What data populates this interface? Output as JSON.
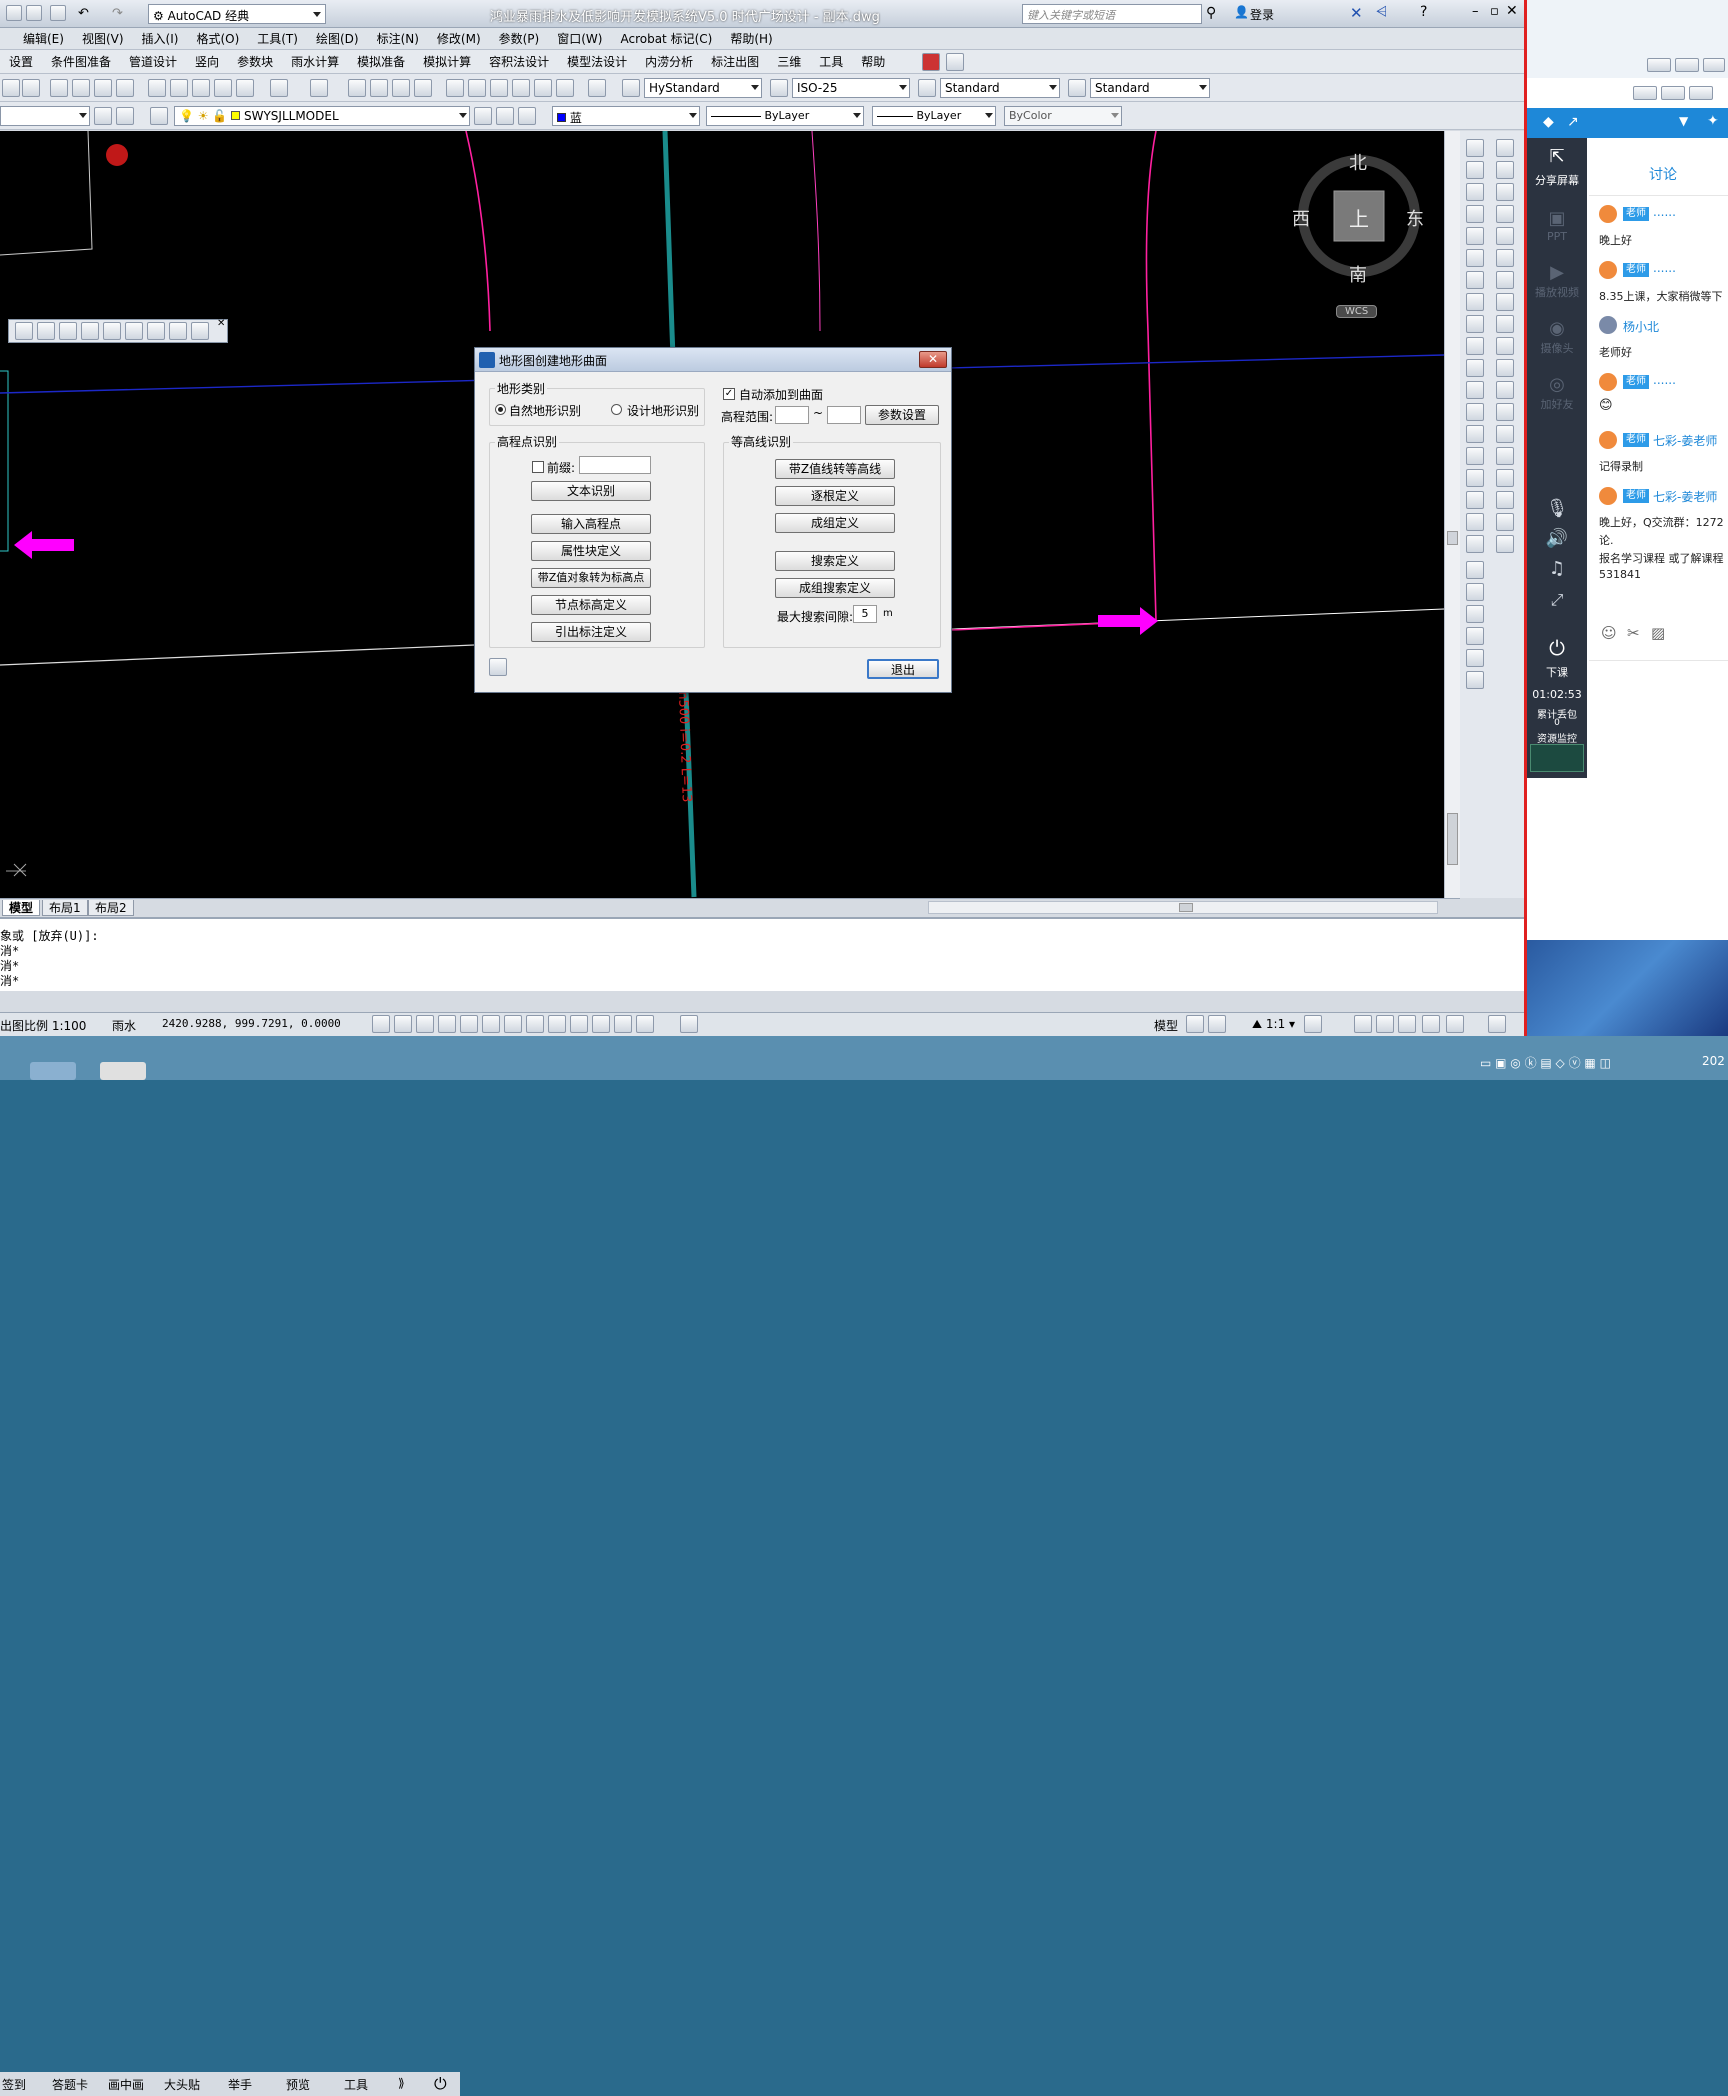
{
  "window": {
    "title": "鸿业暴雨排水及低影响开发模拟系统V5.0    时代广场设计 - 副本.dwg",
    "workspace": "AutoCAD 经典",
    "search_placeholder": "键入关键字或短语",
    "login": "登录"
  },
  "menubar": [
    "编辑(E)",
    "视图(V)",
    "插入(I)",
    "格式(O)",
    "工具(T)",
    "绘图(D)",
    "标注(N)",
    "修改(M)",
    "参数(P)",
    "窗口(W)",
    "Acrobat 标记(C)",
    "帮助(H)"
  ],
  "menubar2": [
    "设置",
    "条件图准备",
    "管道设计",
    "竖向",
    "参数块",
    "雨水计算",
    "模拟准备",
    "模拟计算",
    "容积法设计",
    "模型法设计",
    "内涝分析",
    "标注出图",
    "三维",
    "工具",
    "帮助"
  ],
  "styles": {
    "text_style": "HyStandard",
    "dim_style": "ISO-25",
    "table_style": "Standard",
    "mleader_style": "Standard"
  },
  "layers": {
    "layer_name": "SWYSJLLMODEL",
    "color": "蓝",
    "linetype": "ByLayer",
    "lineweight": "ByLayer",
    "plotstyle": "ByColor"
  },
  "viewcube": {
    "north": "北",
    "south": "南",
    "east": "东",
    "west": "西",
    "top": "上",
    "wcs": "WCS"
  },
  "canvas_label": "n500 i=0.2 L=13",
  "tabs": [
    "模型",
    "布局1",
    "布局2"
  ],
  "command_lines": [
    "象或 [放弃(U)]:",
    "消*",
    "消*",
    "消*"
  ],
  "status": {
    "scale_label": "出图比例 1:100",
    "mode": "雨水",
    "coords": "2420.9288, 999.7291, 0.0000",
    "model_btn": "模型",
    "annot_scale": "1:1"
  },
  "dialog": {
    "title": "地形图创建地形曲面",
    "terrain_type_label": "地形类别",
    "radio_natural": "自然地形识别",
    "radio_design": "设计地形识别",
    "auto_add": "自动添加到曲面",
    "elev_range": "高程范围:",
    "tilde": "~",
    "param_btn": "参数设置",
    "elev_point_group": "高程点识别",
    "prefix": "前缀:",
    "btn_text_recognize": "文本识别",
    "btn_input_point": "输入高程点",
    "btn_attr_block": "属性块定义",
    "btn_z_to_point": "带Z值对象转为标高点",
    "btn_node_elev": "节点标高定义",
    "btn_leader": "引出标注定义",
    "contour_group": "等高线识别",
    "btn_z_to_contour": "带Z值线转等高线",
    "btn_one_by_one": "逐根定义",
    "btn_group_def": "成组定义",
    "btn_search_def": "搜索定义",
    "btn_group_search": "成组搜索定义",
    "max_gap": "最大搜索间隙:",
    "max_gap_value": "5",
    "unit": "m",
    "exit": "退出"
  },
  "taskbar": [
    "签到",
    "答题卡",
    "画中画",
    "大头贴",
    "举手",
    "预览",
    "工具"
  ],
  "chat": {
    "tab": "讨论",
    "share": "分享屏幕",
    "side_items": [
      "PPT",
      "播放视频",
      "摄像头",
      "加好友"
    ],
    "end_class": "下课",
    "timer": "01:02:53",
    "stat1": "累计丢包",
    "stat1_value": "0",
    "stat2": "资源监控",
    "messages": [
      {
        "name": "老师",
        "extra": "......",
        "text": "晚上好"
      },
      {
        "name": "老师",
        "extra": "......",
        "text": "8.35上课，大家稍微等下"
      },
      {
        "name": "杨小北",
        "extra": "",
        "text": "老师好"
      },
      {
        "name": "老师",
        "extra": "......",
        "text": "😊"
      },
      {
        "name": "老师",
        "extra": "七彩-姜老师",
        "text": "记得录制"
      },
      {
        "name": "老师",
        "extra": "七彩-姜老师",
        "text": "晚上好，Q交流群：1272"
      }
    ],
    "extra_lines": [
      "论.",
      "报名学习课程 或了解课程",
      "531841"
    ],
    "date_fragment": "202"
  },
  "colors": {
    "canvas": "#000000",
    "magenta": "#ff00ff",
    "teal": "#1a8c8c",
    "blue_line": "#1c28c8",
    "chat_blue": "#1e88d8"
  }
}
